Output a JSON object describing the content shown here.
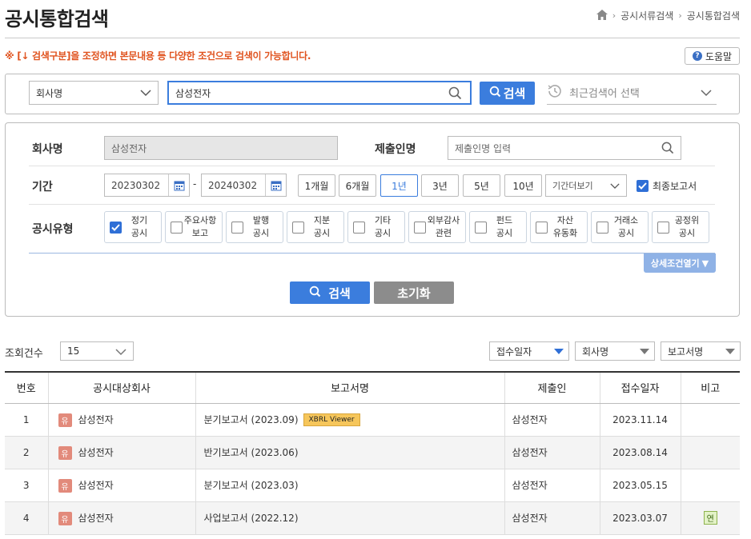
{
  "header": {
    "title": "공시통합검색",
    "breadcrumb": [
      "공시서류검색",
      "공시통합검색"
    ]
  },
  "notice": "※ [↓ 검색구분]을 조정하면 본문내용 등 다양한 조건으로 검색이 가능합니다.",
  "help_label": "도움말",
  "search_bar": {
    "scope": "회사명",
    "query": "삼성전자",
    "search_label": "검색",
    "recent_placeholder": "최근검색어 선택"
  },
  "filters": {
    "company_label": "회사명",
    "company_value": "삼성전자",
    "filer_label": "제출인명",
    "filer_placeholder": "제출인명 입력",
    "period_label": "기간",
    "start_date": "20230302",
    "date_separator": "-",
    "end_date": "20240302",
    "period_buttons": [
      "1개월",
      "6개월",
      "1년",
      "3년",
      "5년",
      "10년"
    ],
    "active_period": "1년",
    "more_period": "기간더보기",
    "final_report_label": "최종보고서",
    "final_report_checked": true,
    "type_label": "공시유형",
    "types": [
      {
        "label": "정기\n공시",
        "checked": true
      },
      {
        "label": "주요사항\n보고",
        "checked": false
      },
      {
        "label": "발행\n공시",
        "checked": false
      },
      {
        "label": "지분\n공시",
        "checked": false
      },
      {
        "label": "기타\n공시",
        "checked": false
      },
      {
        "label": "외부감사\n관련",
        "checked": false
      },
      {
        "label": "펀드\n공시",
        "checked": false
      },
      {
        "label": "자산\n유동화",
        "checked": false
      },
      {
        "label": "거래소\n공시",
        "checked": false
      },
      {
        "label": "공정위\n공시",
        "checked": false
      }
    ],
    "detail_toggle": "상세조건열기",
    "search_button": "검색",
    "reset_button": "초기화"
  },
  "results": {
    "count_label": "조회건수",
    "page_size": "15",
    "sort_options": [
      "접수일자",
      "회사명",
      "보고서명"
    ],
    "columns": [
      "번호",
      "공시대상회사",
      "보고서명",
      "제출인",
      "접수일자",
      "비고"
    ],
    "rows": [
      {
        "no": "1",
        "corp_badge": "유",
        "company": "삼성전자",
        "report": "분기보고서 (2023.09)",
        "xbrl": "XBRL Viewer",
        "filer": "삼성전자",
        "date": "2023.11.14",
        "remark": ""
      },
      {
        "no": "2",
        "corp_badge": "유",
        "company": "삼성전자",
        "report": "반기보고서 (2023.06)",
        "xbrl": "",
        "filer": "삼성전자",
        "date": "2023.08.14",
        "remark": ""
      },
      {
        "no": "3",
        "corp_badge": "유",
        "company": "삼성전자",
        "report": "분기보고서 (2023.03)",
        "xbrl": "",
        "filer": "삼성전자",
        "date": "2023.05.15",
        "remark": ""
      },
      {
        "no": "4",
        "corp_badge": "유",
        "company": "삼성전자",
        "report": "사업보고서 (2022.12)",
        "xbrl": "",
        "filer": "삼성전자",
        "date": "2023.03.07",
        "remark": "연"
      }
    ]
  },
  "colors": {
    "primary": "#3b7ddd",
    "notice": "#e0531f",
    "corp_badge": "#e28a7b",
    "xbrl_badge": "#f6c65b",
    "remark_badge": "#e3f2c7"
  }
}
